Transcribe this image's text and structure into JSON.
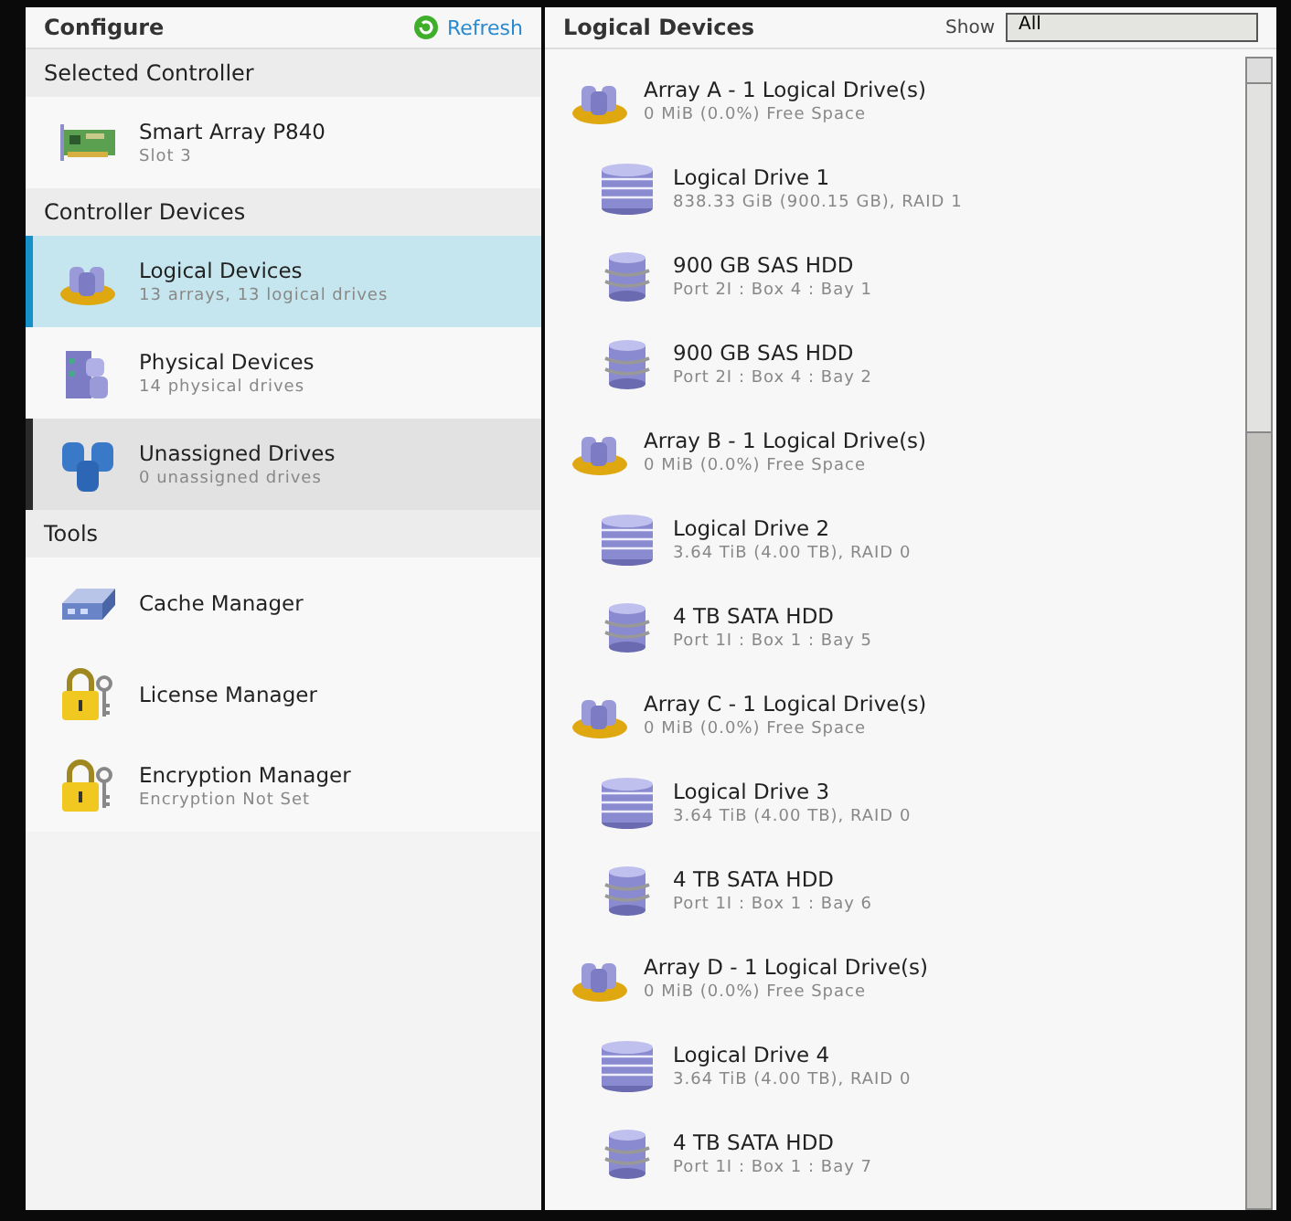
{
  "left_panel": {
    "title": "Configure",
    "refresh": "Refresh",
    "sections": [
      {
        "heading": "Selected Controller",
        "items": [
          {
            "kind": "controller",
            "label": "Smart Array P840",
            "detail": "Slot 3",
            "selected": false,
            "hovered": false
          }
        ]
      },
      {
        "heading": "Controller Devices",
        "items": [
          {
            "kind": "logical",
            "label": "Logical Devices",
            "detail": "13 arrays, 13 logical drives",
            "selected": true,
            "hovered": false
          },
          {
            "kind": "physical",
            "label": "Physical Devices",
            "detail": "14 physical drives",
            "selected": false,
            "hovered": false
          },
          {
            "kind": "unassigned",
            "label": "Unassigned Drives",
            "detail": "0 unassigned drives",
            "selected": false,
            "hovered": true
          }
        ]
      },
      {
        "heading": "Tools",
        "items": [
          {
            "kind": "cache",
            "label": "Cache Manager",
            "selected": false,
            "hovered": false
          },
          {
            "kind": "license",
            "label": "License Manager",
            "selected": false,
            "hovered": false
          },
          {
            "kind": "license",
            "label": "Encryption Manager",
            "detail": "Encryption Not Set",
            "selected": false,
            "hovered": false
          }
        ]
      }
    ]
  },
  "right_panel": {
    "title": "Logical Devices",
    "filter": {
      "label": "Show",
      "value": "All"
    },
    "arrays": [
      {
        "label": "Array A - 1 Logical Drive(s)",
        "detail": "0 MiB (0.0%) Free Space",
        "children": [
          {
            "kind": "logical",
            "label": "Logical Drive 1",
            "detail": "838.33 GiB (900.15 GB), RAID 1"
          },
          {
            "kind": "hdd",
            "label": "900 GB SAS HDD",
            "detail": "Port 2I : Box 4 : Bay 1"
          },
          {
            "kind": "hdd",
            "label": "900 GB SAS HDD",
            "detail": "Port 2I : Box 4 : Bay 2"
          }
        ]
      },
      {
        "label": "Array B - 1 Logical Drive(s)",
        "detail": "0 MiB (0.0%) Free Space",
        "children": [
          {
            "kind": "logical",
            "label": "Logical Drive 2",
            "detail": "3.64 TiB (4.00 TB), RAID 0"
          },
          {
            "kind": "hdd",
            "label": "4 TB SATA HDD",
            "detail": "Port 1I : Box 1 : Bay 5"
          }
        ]
      },
      {
        "label": "Array C - 1 Logical Drive(s)",
        "detail": "0 MiB (0.0%) Free Space",
        "children": [
          {
            "kind": "logical",
            "label": "Logical Drive 3",
            "detail": "3.64 TiB (4.00 TB), RAID 0"
          },
          {
            "kind": "hdd",
            "label": "4 TB SATA HDD",
            "detail": "Port 1I : Box 1 : Bay 6"
          }
        ]
      },
      {
        "label": "Array D - 1 Logical Drive(s)",
        "detail": "0 MiB (0.0%) Free Space",
        "children": [
          {
            "kind": "logical",
            "label": "Logical Drive 4",
            "detail": "3.64 TiB (4.00 TB), RAID 0"
          },
          {
            "kind": "hdd",
            "label": "4 TB SATA HDD",
            "detail": "Port 1I : Box 1 : Bay 7"
          }
        ]
      }
    ]
  }
}
